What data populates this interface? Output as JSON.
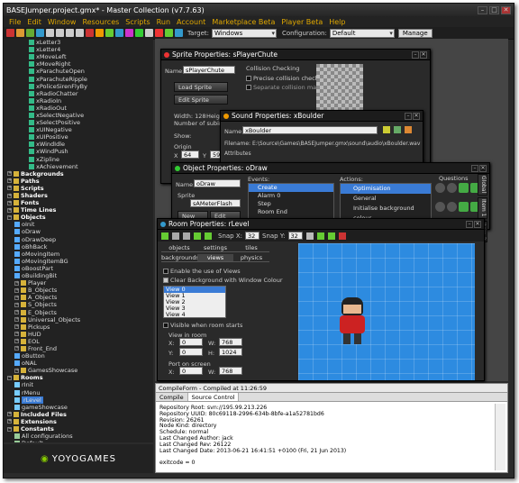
{
  "title": "BASEJumper.project.gmx* - Master Collection (v7.7.63)",
  "menu": [
    "File",
    "Edit",
    "Window",
    "Resources",
    "Scripts",
    "Run",
    "Account",
    "Marketplace Beta",
    "Player Beta",
    "Help"
  ],
  "toolbar": {
    "target_label": "Target:",
    "target_value": "Windows",
    "config_label": "Configuration:",
    "config_value": "Default",
    "manage_label": "Manage"
  },
  "tree": [
    {
      "t": "xLetter3",
      "d": 3,
      "k": "s"
    },
    {
      "t": "xLetter4",
      "d": 3,
      "k": "s"
    },
    {
      "t": "xMoveLeft",
      "d": 3,
      "k": "s"
    },
    {
      "t": "xMoveRight",
      "d": 3,
      "k": "s"
    },
    {
      "t": "xParachuteOpen",
      "d": 3,
      "k": "s"
    },
    {
      "t": "xParachuteRipple",
      "d": 3,
      "k": "s"
    },
    {
      "t": "xPoliceSirenFlyBy",
      "d": 3,
      "k": "s"
    },
    {
      "t": "xRadioChatter",
      "d": 3,
      "k": "s"
    },
    {
      "t": "xRadioIn",
      "d": 3,
      "k": "s"
    },
    {
      "t": "xRadioOut",
      "d": 3,
      "k": "s"
    },
    {
      "t": "xSelectNegative",
      "d": 3,
      "k": "s"
    },
    {
      "t": "xSelectPositive",
      "d": 3,
      "k": "s"
    },
    {
      "t": "xUINegative",
      "d": 3,
      "k": "s"
    },
    {
      "t": "xUIPositive",
      "d": 3,
      "k": "s"
    },
    {
      "t": "xWindIdle",
      "d": 3,
      "k": "s"
    },
    {
      "t": "xWindPush",
      "d": 3,
      "k": "s"
    },
    {
      "t": "xZipline",
      "d": 3,
      "k": "s"
    },
    {
      "t": "xAchievement",
      "d": 3,
      "k": "s"
    },
    {
      "t": "Backgrounds",
      "d": 0,
      "k": "f"
    },
    {
      "t": "Paths",
      "d": 0,
      "k": "f"
    },
    {
      "t": "Scripts",
      "d": 0,
      "k": "f"
    },
    {
      "t": "Shaders",
      "d": 0,
      "k": "f"
    },
    {
      "t": "Fonts",
      "d": 0,
      "k": "f"
    },
    {
      "t": "Time Lines",
      "d": 0,
      "k": "f"
    },
    {
      "t": "Objects",
      "d": 0,
      "k": "fo"
    },
    {
      "t": "oInit",
      "d": 1,
      "k": "o"
    },
    {
      "t": "oDraw",
      "d": 1,
      "k": "o"
    },
    {
      "t": "oDrawDeep",
      "d": 1,
      "k": "o"
    },
    {
      "t": "oBhBack",
      "d": 1,
      "k": "o"
    },
    {
      "t": "oMovingItem",
      "d": 1,
      "k": "o"
    },
    {
      "t": "oMovingItemBG",
      "d": 1,
      "k": "o"
    },
    {
      "t": "oBoostPart",
      "d": 1,
      "k": "o"
    },
    {
      "t": "oBuildingBit",
      "d": 1,
      "k": "o"
    },
    {
      "t": "Player",
      "d": 1,
      "k": "sf"
    },
    {
      "t": "B_Objects",
      "d": 1,
      "k": "sf"
    },
    {
      "t": "A_Objects",
      "d": 1,
      "k": "sf"
    },
    {
      "t": "S_Objects",
      "d": 1,
      "k": "sf"
    },
    {
      "t": "E_Objects",
      "d": 1,
      "k": "sf"
    },
    {
      "t": "Universal_Objects",
      "d": 1,
      "k": "sf"
    },
    {
      "t": "Pickups",
      "d": 1,
      "k": "sf"
    },
    {
      "t": "HUD",
      "d": 1,
      "k": "sf"
    },
    {
      "t": "EOL",
      "d": 1,
      "k": "sf"
    },
    {
      "t": "Front_End",
      "d": 1,
      "k": "sf"
    },
    {
      "t": "oButton",
      "d": 1,
      "k": "o"
    },
    {
      "t": "oNAL",
      "d": 1,
      "k": "o"
    },
    {
      "t": "GamesShowcase",
      "d": 1,
      "k": "sf"
    },
    {
      "t": "Rooms",
      "d": 0,
      "k": "fo"
    },
    {
      "t": "rInit",
      "d": 1,
      "k": "r"
    },
    {
      "t": "rMenu",
      "d": 1,
      "k": "r"
    },
    {
      "t": "rLevel",
      "d": 1,
      "k": "rs"
    },
    {
      "t": "gameShowcase",
      "d": 1,
      "k": "r"
    },
    {
      "t": "Included Files",
      "d": 0,
      "k": "f"
    },
    {
      "t": "Extensions",
      "d": 0,
      "k": "f"
    },
    {
      "t": "Constants",
      "d": 0,
      "k": "fo"
    },
    {
      "t": "All configurations",
      "d": 1,
      "k": "c"
    },
    {
      "t": "Default",
      "d": 1,
      "k": "c"
    },
    {
      "t": "PNL",
      "d": 1,
      "k": "c"
    }
  ],
  "logo": "YOYOGAMES",
  "sprite": {
    "title": "Sprite Properties: sPlayerChute",
    "name_label": "Name:",
    "name": "sPlayerChute",
    "load": "Load Sprite",
    "edit": "Edit Sprite",
    "width": "Width: 128",
    "height": "Height: 1",
    "subimages": "Number of subimages",
    "show": "Show:",
    "origin": "Origin",
    "x_label": "X",
    "x": "64",
    "y_label": "Y",
    "y": "59",
    "collision": "Collision Checking",
    "precise": "Precise collision checking",
    "separate": "Separate collision masks"
  },
  "sound": {
    "title": "Sound Properties: xBoulder",
    "name_label": "Name:",
    "name": "xBoulder",
    "filename": "Filename: E:\\Source\\Games\\BASEJumper.gmx\\sound\\audio\\xBoulder.wav",
    "attributes": "Attributes"
  },
  "object": {
    "title": "Object Properties: oDraw",
    "name_label": "Name:",
    "name": "oDraw",
    "sprite_label": "Sprite",
    "sprite": "sAMeterFlash",
    "new": "New",
    "edit": "Edit",
    "events_label": "Events:",
    "events": [
      "Create",
      "Alarm 0",
      "Step",
      "Room End"
    ],
    "actions_label": "Actions:",
    "actions": [
      "Optimisation",
      "General",
      "Initialise background colour"
    ],
    "questions": "Questions"
  },
  "room": {
    "title": "Room Properties: rLevel",
    "snapx_label": "Snap X:",
    "snapx": "32",
    "snapy_label": "Snap Y:",
    "snapy": "32",
    "tabs": [
      "objects",
      "settings",
      "tiles",
      "backgrounds",
      "views",
      "physics"
    ],
    "enable_views": "Enable the use of Views",
    "clear_bg": "Clear Background with Window Colour",
    "views": [
      "View 0",
      "View 1",
      "View 2",
      "View 3",
      "View 4"
    ],
    "visible_start": "Visible when room starts",
    "view_in_room": "View in room",
    "x_label": "X:",
    "x": "0",
    "w_label": "W:",
    "w": "768",
    "y_label": "Y:",
    "y": "0",
    "h_label": "H:",
    "h": "1024",
    "port_on_screen": "Port on screen",
    "px": "0",
    "pw": "768",
    "py": "0",
    "ph": "1024"
  },
  "compile": {
    "title": "CompileForm - Compiled at 11:26:59",
    "tabs": [
      "Compile",
      "Source Control"
    ],
    "lines": [
      "Repository Root: svn://195.99.213.226",
      "Repository UUID: 80c69118-2996-634b-8bfe-a1a52781bd6",
      "Revision: 26261",
      "Node Kind: directory",
      "Schedule: normal",
      "Last Changed Author: jack",
      "Last Changed Rev: 26122",
      "Last Changed Date: 2013-06-21 16:41:51 +0100 (Fri, 21 Jun 2013)",
      "",
      "exitcode = 0"
    ]
  },
  "sidetabs": [
    "Global",
    "Item 1",
    "Item 2"
  ]
}
